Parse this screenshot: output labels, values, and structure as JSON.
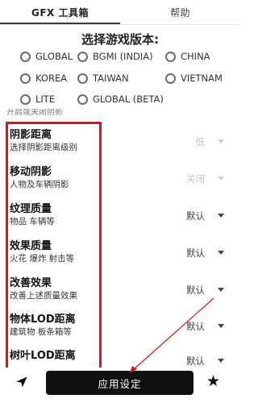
{
  "tabs": [
    {
      "label": "GFX 工具箱"
    },
    {
      "label": "帮助"
    }
  ],
  "version_section": {
    "title": "选择游戏版本:",
    "options": [
      {
        "label": "GLOBAL"
      },
      {
        "label": "BGMI (INDIA)"
      },
      {
        "label": "CHINA"
      },
      {
        "label": "KOREA"
      },
      {
        "label": "TAIWAN"
      },
      {
        "label": "VIETNAM"
      },
      {
        "label": "LITE"
      },
      {
        "label": "GLOBAL (BETA)"
      }
    ]
  },
  "clipped_label": "开启或关闭阴影",
  "settings": [
    {
      "title": "阴影距离",
      "subtitle": "选择阴影距离级别",
      "value": "低"
    },
    {
      "title": "移动阴影",
      "subtitle": "人物及车辆阴影",
      "value": "关闭"
    },
    {
      "title": "纹理质量",
      "subtitle": "物品 车辆等",
      "value": "默认"
    },
    {
      "title": "效果质量",
      "subtitle": "火花 爆炸 射击等",
      "value": "默认"
    },
    {
      "title": "改善效果",
      "subtitle": "改善上述质量效果",
      "value": "默认"
    },
    {
      "title": "物体LOD距离",
      "subtitle": "建筑物 板条箱等",
      "value": "默认"
    },
    {
      "title": "树叶LOD距离",
      "subtitle": "",
      "value": "默认"
    }
  ],
  "bottom": {
    "apply_label": "应用设定",
    "send_icon": "send-icon",
    "star_icon": "star-icon"
  },
  "colors": {
    "highlight_box": "#d6141d",
    "button_bg": "#111111"
  }
}
